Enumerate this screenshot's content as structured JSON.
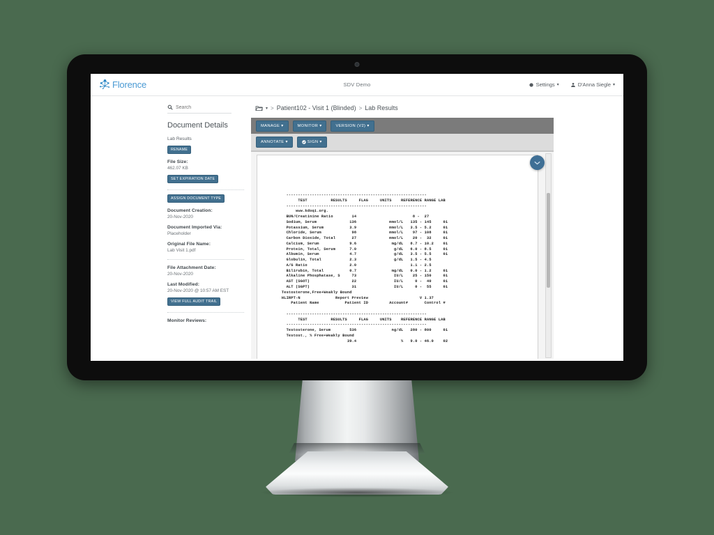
{
  "theme": {
    "background": "#4a6a4f",
    "bezel": "#0d0d0d",
    "brand_blue": "#4a9ad4",
    "button_blue": "#42708f",
    "toolbar_dark": "#7b7b7b",
    "toolbar_light": "#dcdcdc"
  },
  "header": {
    "logo_text": "Florence",
    "logo_icon": "network-nodes-icon",
    "environment_label": "SDV Demo",
    "settings_label": "Settings",
    "settings_icon": "gear-icon",
    "user_label": "D'Anna Siegle",
    "user_icon": "user-icon",
    "caret": "▾"
  },
  "sidebar": {
    "search": {
      "icon": "search-icon",
      "placeholder": "Search",
      "value": ""
    },
    "title": "Document Details",
    "document_name": "Lab Results",
    "rename_button": "RENAME",
    "file_size_label": "File Size:",
    "file_size_value": "462.07 KB",
    "set_expiration_button": "SET EXPIRATION DATE",
    "assign_type_button": "ASSIGN DOCUMENT TYPE",
    "document_creation_label": "Document Creation:",
    "document_creation_value": "20-Nov-2020",
    "imported_via_label": "Document Imported Via:",
    "imported_via_value": "Placeholder",
    "original_filename_label": "Original File Name:",
    "original_filename_value": "Lab Visit 1.pdf",
    "attachment_date_label": "File Attachment Date:",
    "attachment_date_value": "20-Nov-2020",
    "last_modified_label": "Last Modified:",
    "last_modified_value": "20-Nov-2020 @ 10:57 AM EST",
    "audit_trail_button": "VIEW FULL AUDIT TRAIL",
    "monitor_reviews_label": "Monitor Reviews:"
  },
  "breadcrumb": {
    "folder_icon": "folder-icon",
    "caret": "▾",
    "separator": ">",
    "item1": "Patient102 - Visit 1  (Blinded)",
    "item2": "Lab Results"
  },
  "toolbar": {
    "manage_label": "MANAGE",
    "monitor_label": "MONITOR",
    "version_label": "VERSION (V2)",
    "annotate_label": "ANNOTATE",
    "sign_label": "SIGN",
    "sign_icon": "check-circle-icon",
    "caret": "▾"
  },
  "viewer": {
    "collapse_icon": "chevron-down-icon",
    "scrollbar": "vertical-scrollbar",
    "document_text": "          ------------------------------------------------------------\n               TEST          RESULTS     FLAG     UNITS    REFERENCE RANGE LAB\n          ------------------------------------------------------------\n              www.kdoqi.org.\n          BUN/Creatinine Ratio        14                        8 -  27\n          Sodium, Serum              136              mmol/L   135 - 145     01\n          Potassium, Serum           3.9              mmol/L   3.5 - 5.2     01\n          Chloride, Serum             98              mmol/L    97 - 108     01\n          Carbon Dioxide, Total       27              mmol/L    20 -  32     01\n          Calcium, Serum             9.6               mg/dL   8.7 - 10.2    01\n          Protein, Total, Serum      7.0                g/dL   6.0 - 8.5     01\n          Albumin, Serum             4.7                g/dL   3.5 - 5.5     01\n          Globulin, Total            2.3                g/dL   1.5 - 4.5\n          A/G Ratio                  2.0                       1.1 - 2.5\n          Bilirubin, Total           0.7               mg/dL   0.0 - 1.2     01\n          Alkaline Phosphatase, S     73                IU/L    25 - 150     01\n          AST (SGOT)                  22                IU/L     0 -  40     01\n          ALT (SGPT)                  31                IU/L     0 -  55     01\n        Testosterone,Free+Weakly Bound\n        HLIRPT-N               Report Preview                      V 1.37\n            Patient Name           Patient ID         Account#       Control #\n\n          ------------------------------------------------------------\n               TEST          RESULTS     FLAG     UNITS    REFERENCE RANGE LAB\n          ------------------------------------------------------------\n          Testosterone, Serum        536               ng/dL   280 - 800     01\n          Testost., % Free+Weakly Bound\n                                    39.4                   %   9.0 - 46.0    02"
  }
}
